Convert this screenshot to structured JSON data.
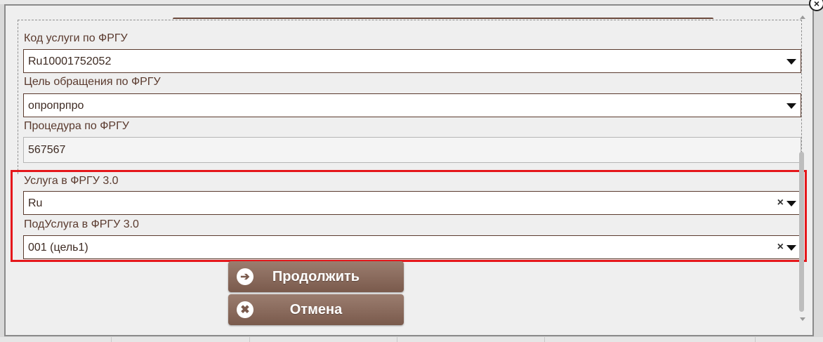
{
  "form": {
    "service_code": {
      "label": "Код услуги по ФРГУ",
      "value": "Ru10001752052"
    },
    "appeal_goal": {
      "label": "Цель обращения по ФРГУ",
      "value": "опропрпро"
    },
    "procedure": {
      "label": "Процедура по ФРГУ",
      "value": "567567"
    },
    "service_v3": {
      "label": "Услуга в ФРГУ 3.0",
      "value": "Ru"
    },
    "subservice_v3": {
      "label": "ПодУслуга в ФРГУ 3.0",
      "value": "001 (цель1)"
    }
  },
  "buttons": {
    "continue_label": "Продолжить",
    "cancel_label": "Отмена"
  },
  "icons": {
    "close": "×",
    "clear": "×",
    "continue": "➔",
    "cancel": "✖"
  },
  "colors": {
    "highlight": "#e5171b",
    "button": "#8a6b5d",
    "text": "#5a3a2e"
  }
}
